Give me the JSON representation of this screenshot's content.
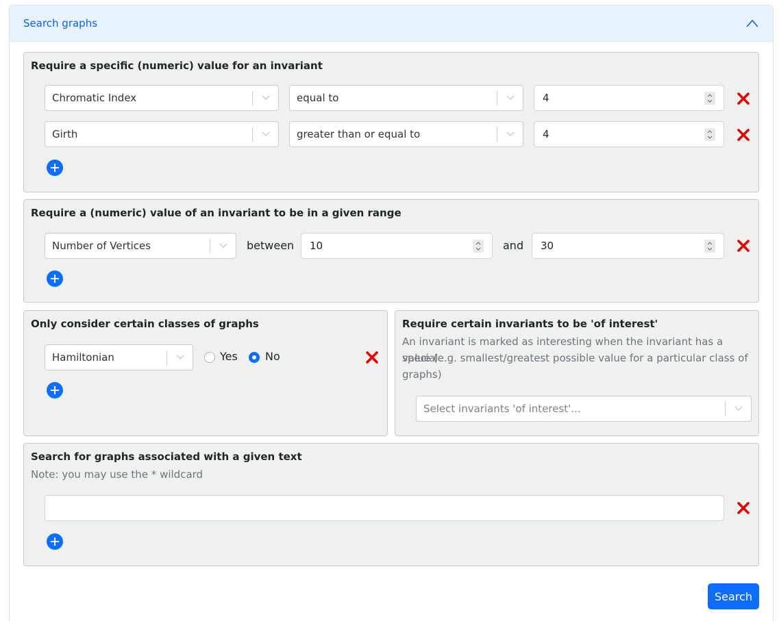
{
  "accordion": {
    "title": "Search graphs"
  },
  "specific_values": {
    "title": "Require a specific (numeric) value for an invariant",
    "rows": [
      {
        "invariant": "Chromatic Index",
        "comparison": "equal to",
        "value": "4"
      },
      {
        "invariant": "Girth",
        "comparison": "greater than or equal to",
        "value": "4"
      }
    ]
  },
  "range_values": {
    "title": "Require a (numeric) value of an invariant to be in a given range",
    "rows": [
      {
        "invariant": "Number of Vertices",
        "between_label": "between",
        "min": "10",
        "and_label": "and",
        "max": "30"
      }
    ]
  },
  "classes": {
    "title": "Only consider certain classes of graphs",
    "rows": [
      {
        "class": "Hamiltonian",
        "yes_label": "Yes",
        "no_label": "No",
        "selected": "No"
      }
    ]
  },
  "interest": {
    "title": "Require certain invariants to be 'of interest'",
    "note_line1": "An invariant is marked as interesting when the invariant has a special",
    "note_line2": "value (e.g. smallest/greatest possible value for a particular class of",
    "note_line3": "graphs)",
    "placeholder": "Select invariants 'of interest'..."
  },
  "text_search": {
    "title": "Search for graphs associated with a given text",
    "note": "Note: you may use the * wildcard",
    "value": ""
  },
  "search_button": {
    "label": "Search"
  },
  "colors": {
    "accent": "#0d6efd",
    "remove": "#e00000",
    "card_bg": "#eff1ee",
    "header_bg": "#e7f1ff"
  }
}
